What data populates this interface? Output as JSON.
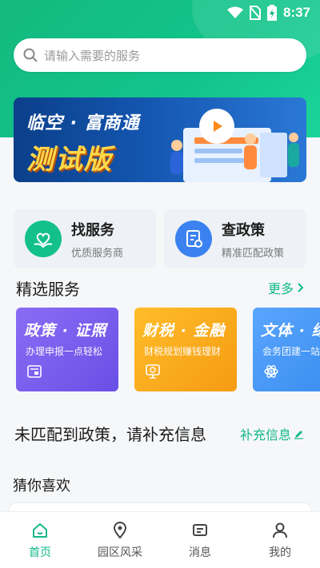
{
  "status_bar": {
    "time": "8:37"
  },
  "search": {
    "placeholder": "请输入需要的服务"
  },
  "banner": {
    "title": "临空 · 富商通",
    "subtitle": "测试版"
  },
  "quick_cards": [
    {
      "title": "找服务",
      "subtitle": "优质服务商",
      "icon": "heart-hand-icon"
    },
    {
      "title": "查政策",
      "subtitle": "精准匹配政策",
      "icon": "policy-document-icon"
    }
  ],
  "featured": {
    "title": "精选服务",
    "more_label": "更多",
    "items": [
      {
        "title": "政策 · 证照",
        "subtitle": "办理申报一点轻松",
        "icon": "certificate-icon",
        "color": "#7a5cf0"
      },
      {
        "title": "财税 · 金融",
        "subtitle": "财税规划赚钱理财",
        "icon": "finance-monitor-icon",
        "color": "#f5a21c"
      },
      {
        "title": "文体 · 综",
        "subtitle": "会务团建一站",
        "icon": "atom-icon",
        "color": "#3d8ff0"
      }
    ]
  },
  "match_prompt": {
    "text": "未匹配到政策，请补充信息",
    "action_label": "补充信息"
  },
  "recommend": {
    "title": "猜你喜欢"
  },
  "tabbar": [
    {
      "label": "首页",
      "icon": "home-icon",
      "active": true
    },
    {
      "label": "园区风采",
      "icon": "location-pin-icon",
      "active": false
    },
    {
      "label": "消息",
      "icon": "message-icon",
      "active": false
    },
    {
      "label": "我的",
      "icon": "user-icon",
      "active": false
    }
  ],
  "colors": {
    "brand_green": "#12b888",
    "banner_blue": "#1456b0"
  }
}
